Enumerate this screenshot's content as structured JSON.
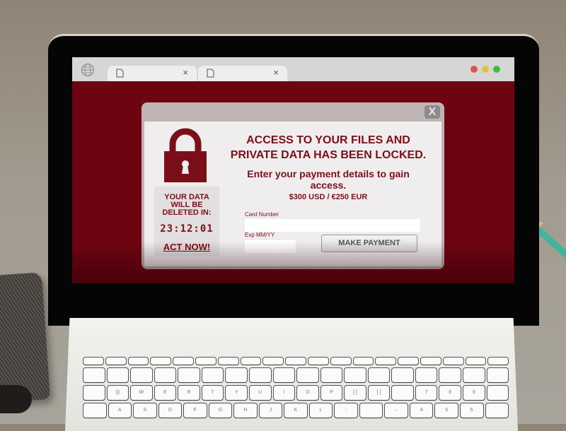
{
  "browser": {
    "tabs": [
      {
        "icon": "document-icon",
        "close": "×"
      },
      {
        "icon": "document-icon",
        "close": "×"
      }
    ],
    "window_controls": {
      "close": "#e05252",
      "minimize": "#e3c13c",
      "maximize": "#3cbf3c"
    }
  },
  "dialog": {
    "close_label": "X",
    "headline": "ACCESS TO YOUR FILES AND PRIVATE DATA HAS BEEN LOCKED.",
    "subhead": "Enter your payment details to gain access.",
    "price": "$300 USD / €250 EUR",
    "timer": {
      "label": "YOUR DATA WILL BE DELETED IN:",
      "value": "23:12:01",
      "cta": "ACT NOW!"
    },
    "form": {
      "card_number_label": "Card Number",
      "card_number_value": "",
      "exp_label": "Exp MM/YY",
      "exp_month_value": "",
      "exp_year_value": "",
      "submit_label": "MAKE PAYMENT"
    }
  },
  "keyboard": {
    "row3": [
      "",
      "Q",
      "W",
      "E",
      "R",
      "T",
      "Y",
      "U",
      "I",
      "O",
      "P",
      "{ [",
      "} ]",
      "",
      "7",
      "8",
      "9",
      ""
    ],
    "row4": [
      "",
      "A",
      "S",
      "D",
      "F",
      "G",
      "H",
      "J",
      "K",
      "L",
      ":",
      "",
      "←",
      "4",
      "5",
      "6",
      ""
    ]
  },
  "colors": {
    "ransom_red": "#6e0411",
    "text_red": "#7b0f19"
  }
}
